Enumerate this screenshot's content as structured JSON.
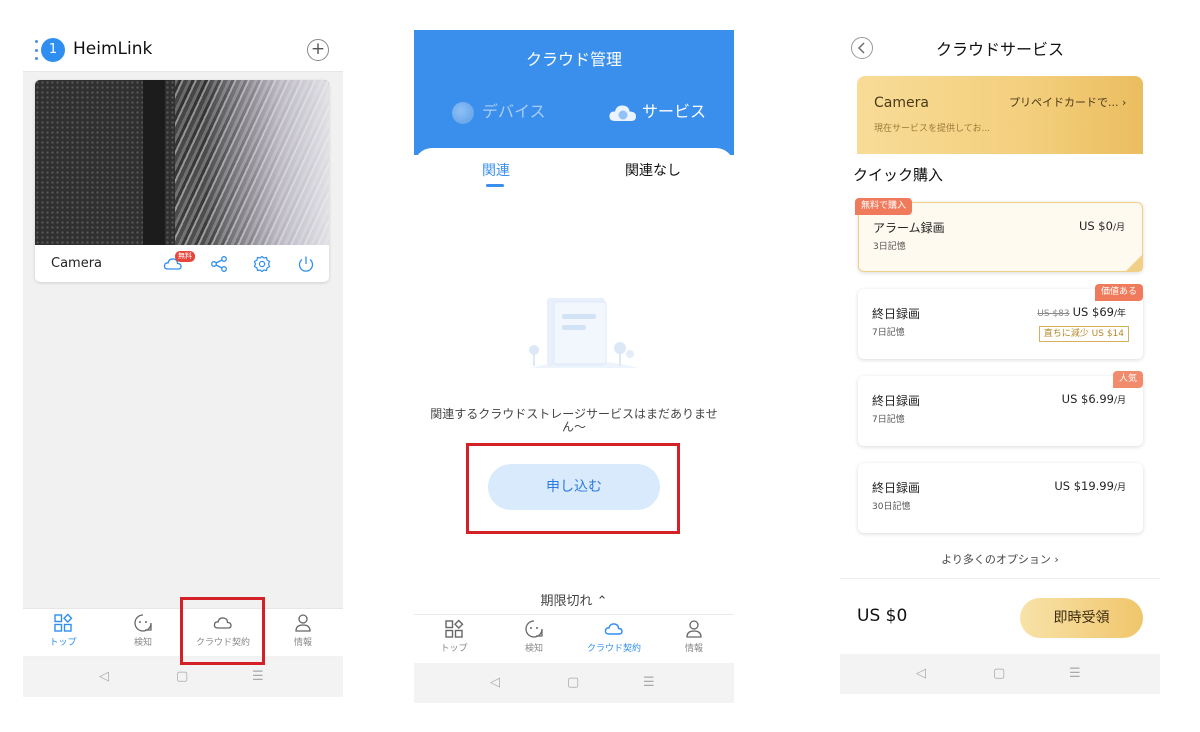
{
  "phone1": {
    "header": {
      "badge": "1",
      "app_name": "HeimLink",
      "add_label": "+"
    },
    "device_card": {
      "name": "Camera",
      "cloud_badge": "無料"
    },
    "tabbar": [
      {
        "label": "トップ",
        "icon": "grid-icon",
        "active": true
      },
      {
        "label": "検知",
        "icon": "face-icon",
        "active": false
      },
      {
        "label": "クラウド契約",
        "icon": "cloud-icon",
        "active": false
      },
      {
        "label": "情報",
        "icon": "person-icon",
        "active": false
      }
    ],
    "navbar": {
      "back": "◁",
      "home": "▢",
      "menu": "☰"
    }
  },
  "phone2": {
    "title": "クラウド管理",
    "segments": {
      "devices": "デバイス",
      "services": "サービス"
    },
    "tabs": {
      "related": "関連",
      "unrelated": "関連なし"
    },
    "empty_message": "関連するクラウドストレージサービスはまだありません〜",
    "apply_button": "申し込む",
    "expired_toggle": "期限切れ ⌃",
    "tabbar": [
      {
        "label": "トップ",
        "icon": "grid-icon",
        "active": false
      },
      {
        "label": "検知",
        "icon": "face-icon",
        "active": false
      },
      {
        "label": "クラウド契約",
        "icon": "cloud-icon",
        "active": true
      },
      {
        "label": "情報",
        "icon": "person-icon",
        "active": false
      }
    ],
    "navbar": {
      "back": "◁",
      "home": "▢",
      "menu": "☰"
    }
  },
  "phone3": {
    "title": "クラウドサービス",
    "device": {
      "name": "Camera",
      "status": "現在サービスを提供してお...",
      "prepaid_link": "プリペイドカードで... ›"
    },
    "quick_purchase_title": "クイック購入",
    "plans": [
      {
        "tag": "無料で購入",
        "name": "アラーム録画",
        "retention": "3日記憶",
        "price": "US $0",
        "unit": "/月",
        "selected": true
      },
      {
        "tag": "価値ある",
        "name": "終日録画",
        "retention": "7日記憶",
        "old_price": "US $83",
        "price": "US $69",
        "unit": "/年",
        "discount": "直ちに減少 US $14",
        "selected": false
      },
      {
        "tag": "人気",
        "name": "終日録画",
        "retention": "7日記憶",
        "price": "US $6.99",
        "unit": "/月",
        "selected": false
      },
      {
        "name": "終日録画",
        "retention": "30日記憶",
        "price": "US $19.99",
        "unit": "/月",
        "selected": false
      }
    ],
    "more_options": "より多くのオプション ›",
    "total": "US $0",
    "buy_button": "即時受領",
    "navbar": {
      "back": "◁",
      "home": "▢",
      "menu": "☰"
    }
  },
  "colors": {
    "primary_blue": "#3b8fec",
    "highlight_red": "#d42127",
    "gold": "#f3cf7d",
    "tag_orange": "#f07b5c"
  }
}
